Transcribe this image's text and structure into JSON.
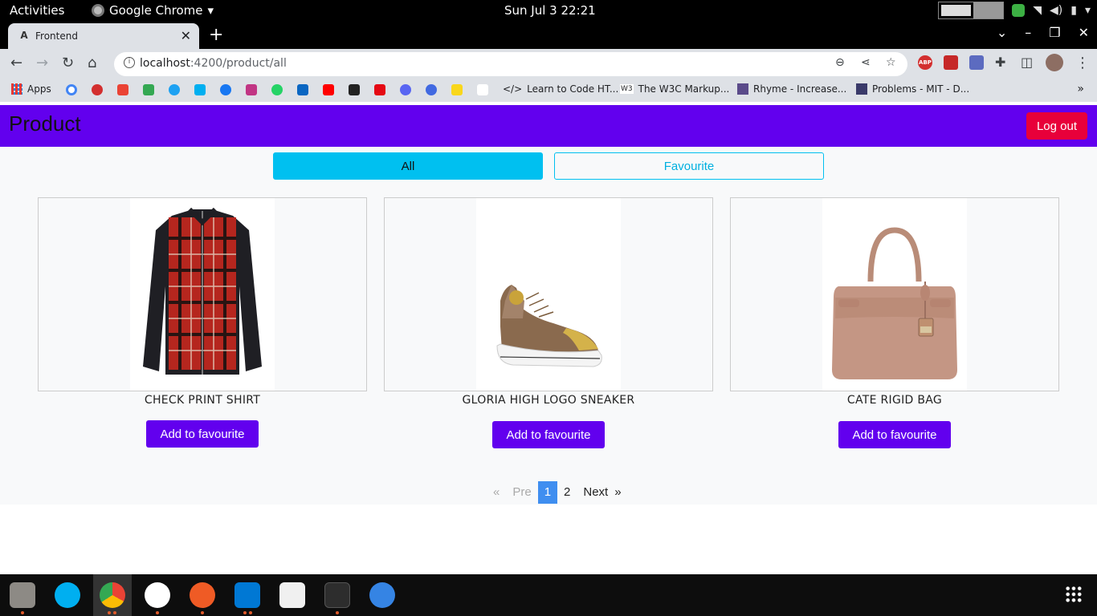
{
  "system": {
    "activities": "Activities",
    "app_menu": "Google Chrome",
    "clock": "Sun Jul 3  22:21"
  },
  "browser": {
    "tab_title": "Frontend",
    "url_host": "localhost",
    "url_path": ":4200/product/all",
    "bookmarks": {
      "apps": "Apps",
      "learn": "Learn to Code HT...",
      "w3c": "The W3C Markup...",
      "rhyme": "Rhyme - Increase...",
      "mit": "Problems - MIT - D..."
    },
    "extensions": {
      "abp": "ABP"
    }
  },
  "app": {
    "brand": "Product",
    "logout": "Log out",
    "tabs": {
      "all": "All",
      "favourite": "Favourite"
    },
    "products": [
      {
        "name": "CHECK PRINT SHIRT",
        "button": "Add to favourite"
      },
      {
        "name": "GLORIA HIGH LOGO SNEAKER",
        "button": "Add to favourite"
      },
      {
        "name": "CATE RIGID BAG",
        "button": "Add to favourite"
      }
    ],
    "pagination": {
      "first": "«",
      "prev": "Pre",
      "pages": [
        "1",
        "2"
      ],
      "current": "1",
      "next": "Next",
      "last": "»"
    }
  },
  "colors": {
    "navbar": "#6200ee",
    "logout": "#e8003a",
    "segment": "#00c0f0",
    "page_active": "#3f8ef0"
  }
}
